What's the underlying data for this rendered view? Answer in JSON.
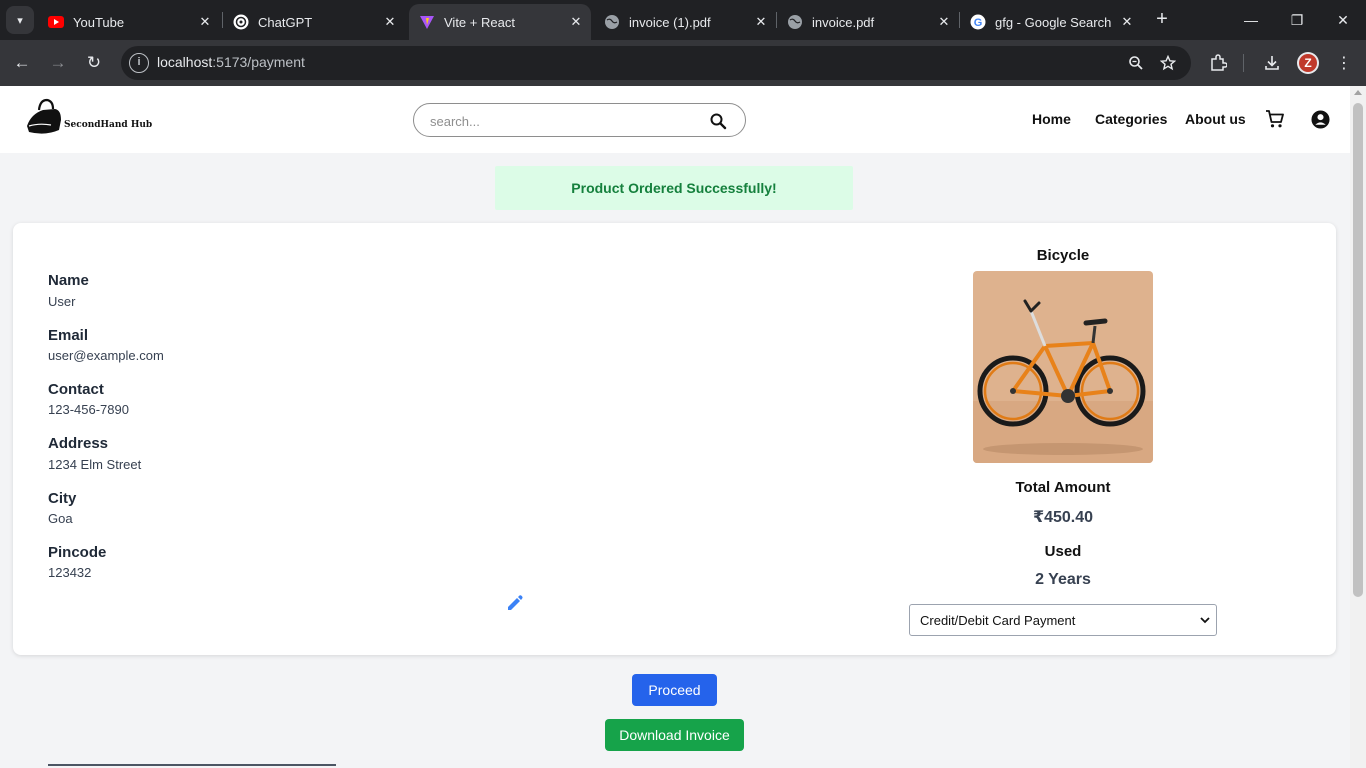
{
  "browser": {
    "tabs": [
      {
        "title": "YouTube",
        "icon": "youtube-icon",
        "active": false
      },
      {
        "title": "ChatGPT",
        "icon": "chatgpt-icon",
        "active": false
      },
      {
        "title": "Vite + React",
        "icon": "vite-icon",
        "active": true
      },
      {
        "title": "invoice (1).pdf",
        "icon": "globe-icon",
        "active": false
      },
      {
        "title": "invoice.pdf",
        "icon": "globe-icon",
        "active": false
      },
      {
        "title": "gfg - Google Search",
        "icon": "google-icon",
        "active": false
      }
    ],
    "url_host": "localhost",
    "url_path": ":5173/payment",
    "profile_initial": "Z"
  },
  "header": {
    "logo_text": "SecondHand Hub",
    "search_placeholder": "search...",
    "nav": [
      "Home",
      "Categories",
      "About us"
    ]
  },
  "toast": "Product Ordered Successfully!",
  "user": {
    "fields": [
      {
        "label": "Name",
        "value": "User"
      },
      {
        "label": "Email",
        "value": "user@example.com"
      },
      {
        "label": "Contact",
        "value": "123-456-7890"
      },
      {
        "label": "Address",
        "value": "1234 Elm Street"
      },
      {
        "label": "City",
        "value": "Goa"
      },
      {
        "label": "Pincode",
        "value": "123432"
      }
    ]
  },
  "product": {
    "name": "Bicycle",
    "total_label": "Total Amount",
    "total_value": "₹450.40",
    "used_label": "Used",
    "used_value": "2 Years",
    "payment_method": "Credit/Debit Card Payment"
  },
  "actions": {
    "proceed": "Proceed",
    "download_invoice": "Download Invoice"
  },
  "colors": {
    "primary_button": "#2563eb",
    "success_button": "#16a34a",
    "toast_bg": "#dcfce7",
    "toast_text": "#15803d"
  }
}
